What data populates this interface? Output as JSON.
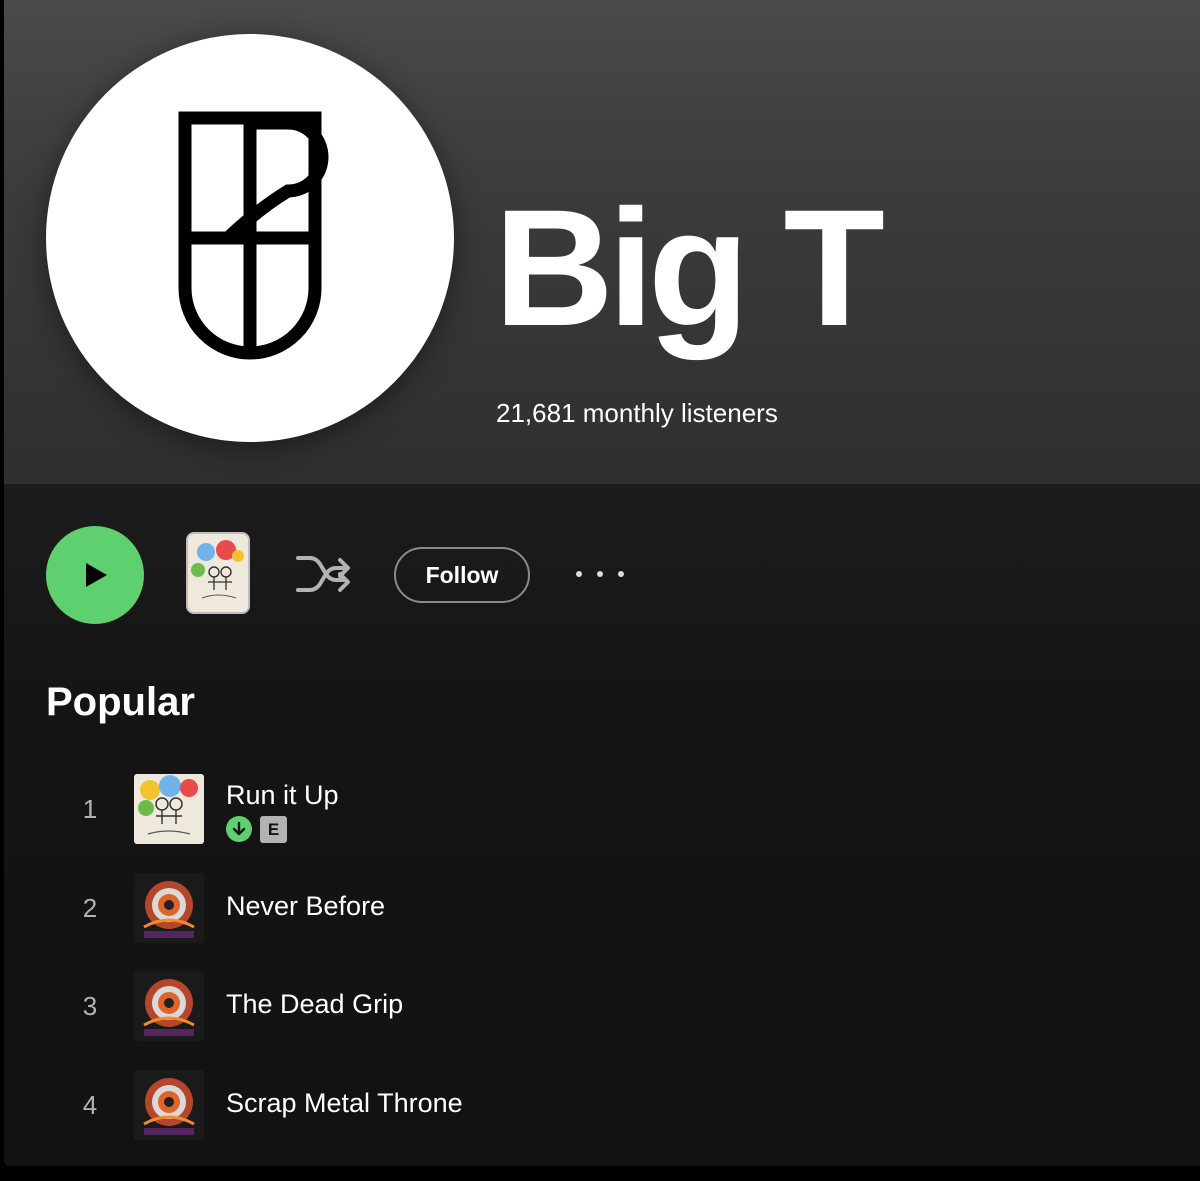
{
  "artist": {
    "name": "Big T",
    "monthly_listeners": "21,681 monthly listeners"
  },
  "actions": {
    "follow_label": "Follow"
  },
  "popular": {
    "title": "Popular",
    "tracks": [
      {
        "num": "1",
        "title": "Run it Up",
        "explicit": "E",
        "downloaded": true
      },
      {
        "num": "2",
        "title": "Never Before"
      },
      {
        "num": "3",
        "title": "The Dead Grip"
      },
      {
        "num": "4",
        "title": "Scrap Metal Throne"
      }
    ]
  },
  "colors": {
    "accent_green": "#5fd070",
    "background": "#121212",
    "header_gray": "#3b3b3b"
  },
  "icons": [
    "play-icon",
    "shuffle-icon",
    "more-icon",
    "download-icon",
    "explicit-badge"
  ]
}
